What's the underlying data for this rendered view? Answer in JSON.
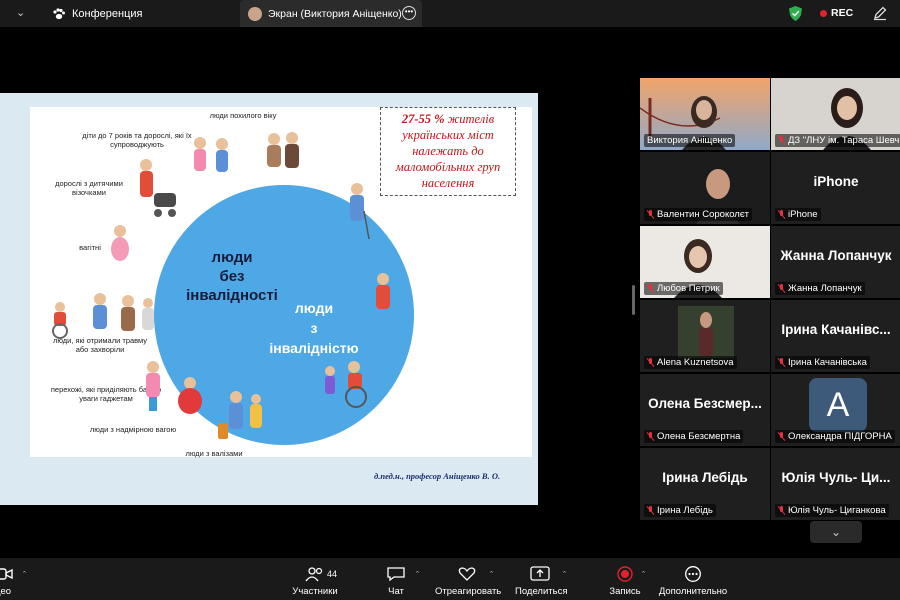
{
  "top_bar": {
    "conference_label": "Конференция",
    "screen_tab_label": "Экран (Виктория Аніщенко)",
    "rec_label": "REC"
  },
  "slide": {
    "circle_text_1": "люди\nбез\nінвалідності",
    "circle_text_2": "люди\nз\nінвалідністю",
    "labels": {
      "elderly": "люди похилого віку",
      "children": "діти до 7 років та дорослі, які їх супроводжують",
      "strollers": "дорослі з дитячими візочками",
      "pregnant": "вагітні",
      "injured": "люди, які отримали травму або захворіли",
      "gadgets": "перехожі, які приділяють багато уваги гаджетам",
      "overweight": "люди з надмірною вагою",
      "luggage": "люди з валізами"
    },
    "callout_bold": "27-55 %",
    "callout_text": "жителів українських міст належать до маломобільних груп населення",
    "author": "д.пед.н., професор Аніщенко В. О."
  },
  "gallery": {
    "tiles": [
      {
        "name": "Виктория Аніщенко",
        "big": ""
      },
      {
        "name": "ДЗ \"ЛНУ ім. Тараса Шевч...",
        "big": ""
      },
      {
        "name": "Валентин Сороколєт",
        "big": ""
      },
      {
        "name": "iPhone",
        "big": "iPhone"
      },
      {
        "name": "Любов Петрик",
        "big": ""
      },
      {
        "name": "Жанна Лопанчук",
        "big": "Жанна Лопанчук"
      },
      {
        "name": "Alena Kuznetsova",
        "big": ""
      },
      {
        "name": "Ірина Качанівська",
        "big": "Ірина Качанівс..."
      },
      {
        "name": "Олена Безсмертна",
        "big": "Олена Безсмер..."
      },
      {
        "name": "Олександра ПІДГОРНА",
        "big": "A"
      },
      {
        "name": "Ірина Лебідь",
        "big": "Ірина Лебідь"
      },
      {
        "name": "Юлія Чуль- Циганкова",
        "big": "Юлія Чуль- Ци..."
      }
    ]
  },
  "bottom_bar": {
    "video_label": "део",
    "participants_label": "Участники",
    "participants_count": "44",
    "chat_label": "Чат",
    "react_label": "Отреагировать",
    "share_label": "Поделиться",
    "record_label": "Запись",
    "more_label": "Дополнительно"
  },
  "colors": {
    "active_speaker": "#31c25b",
    "circle": "#4ea8e5",
    "callout_red": "#c0161b",
    "record_red": "#e0222f"
  }
}
